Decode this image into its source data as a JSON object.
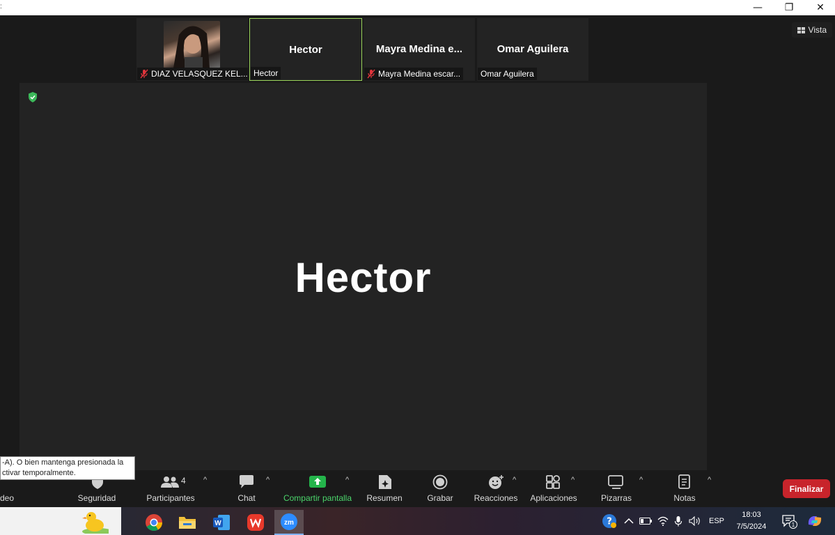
{
  "window": {
    "minimize_glyph": "—",
    "restore_glyph": "❐",
    "close_glyph": "✕"
  },
  "view_button": {
    "label": "Vista",
    "icon": "grid-icon"
  },
  "participants_strip": [
    {
      "tile_name": "",
      "label": "DIAZ VELASQUEZ KEL...",
      "muted": true,
      "has_photo": true
    },
    {
      "tile_name": "Hector",
      "label": "Hector",
      "muted": false,
      "active_speaker": true
    },
    {
      "tile_name": "Mayra  Medina  e...",
      "label": "Mayra Medina escar...",
      "muted": true
    },
    {
      "tile_name": "Omar Aguilera",
      "label": "Omar Aguilera",
      "muted": false
    }
  ],
  "main_stage": {
    "speaker_name": "Hector",
    "security_indicator": "shield-check-icon"
  },
  "tooltip": {
    "line1": "-A). O bien mantenga presionada la",
    "line2": "ctivar temporalmente."
  },
  "toolbar": {
    "video_label": "deo",
    "security_label": "Seguridad",
    "participants_label": "Participantes",
    "participants_count": "4",
    "chat_label": "Chat",
    "share_label": "Compartir pantalla",
    "summary_label": "Resumen",
    "record_label": "Grabar",
    "reactions_label": "Reacciones",
    "apps_label": "Aplicaciones",
    "whiteboards_label": "Pizarras",
    "notes_label": "Notas",
    "end_label": "Finalizar",
    "caret": "^"
  },
  "taskbar": {
    "apps": [
      "chrome-icon",
      "file-explorer-icon",
      "word-icon",
      "wps-office-icon",
      "zoom-icon"
    ],
    "zoom_badge": "zm",
    "word_badge": "W",
    "language": "ESP",
    "time": "18:03",
    "date": "7/5/2024",
    "notification_count": "1"
  },
  "colors": {
    "share_green": "#4bd56b",
    "end_red": "#c8242b",
    "active_border": "#9bd65b",
    "stage_bg": "#232323"
  }
}
